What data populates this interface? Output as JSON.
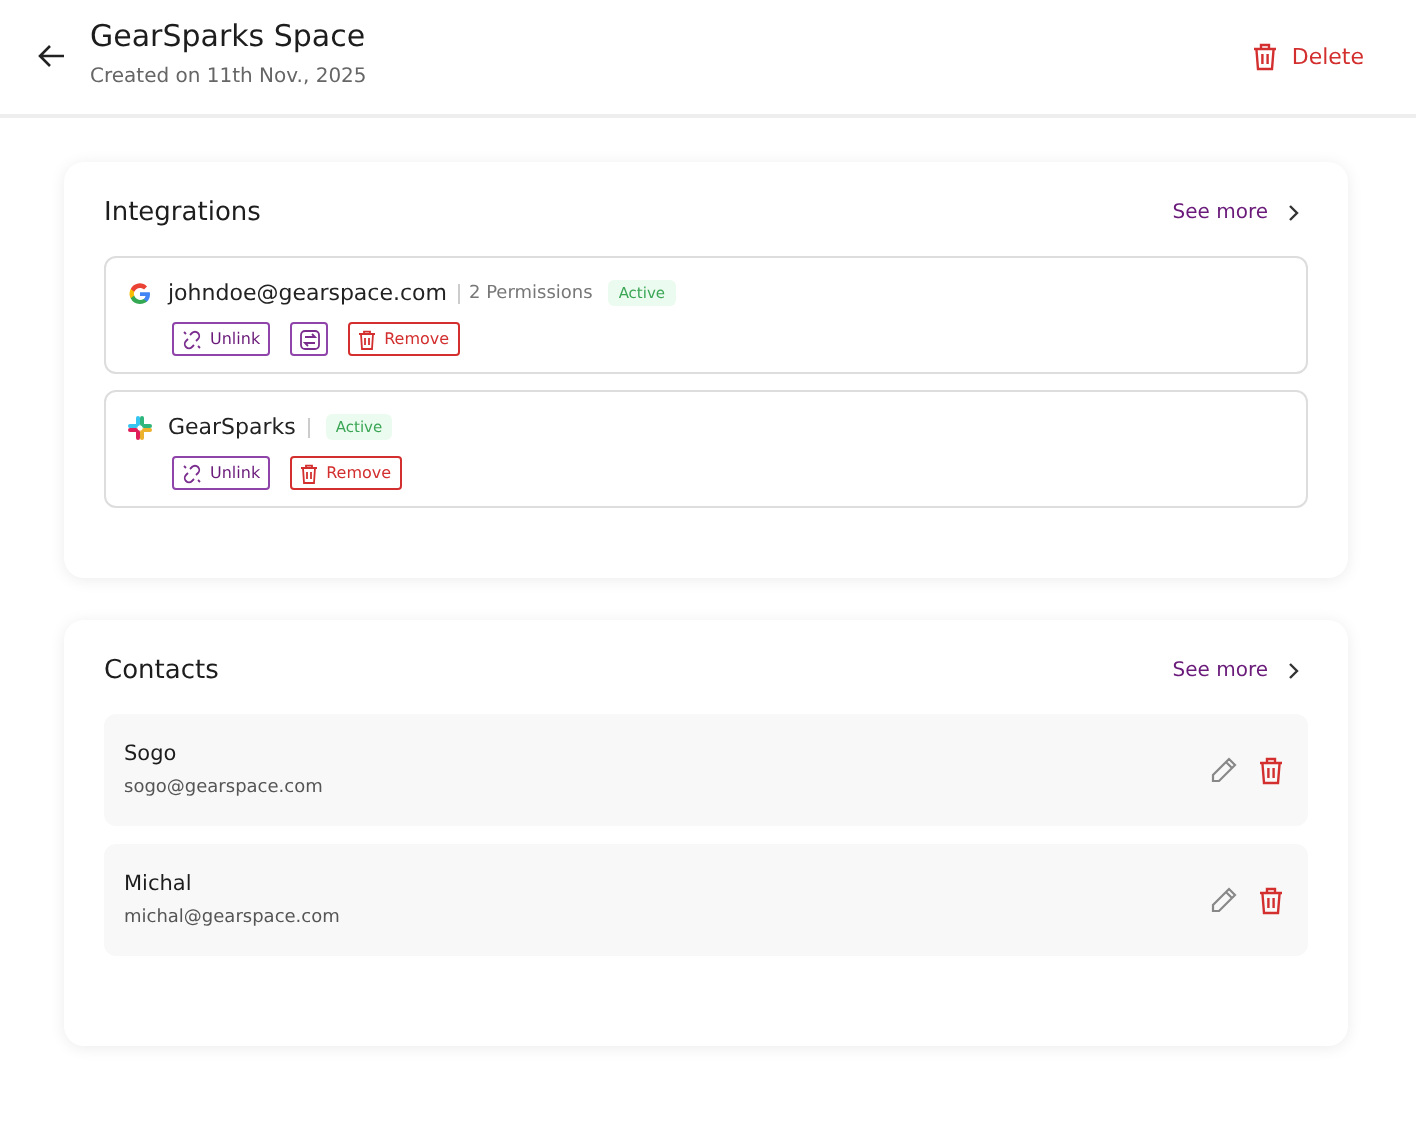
{
  "header": {
    "title": "GearSparks Space",
    "subtitle": "Created on 11th Nov., 2025",
    "delete_label": "Delete"
  },
  "integrations": {
    "title": "Integrations",
    "see_more": "See more",
    "items": [
      {
        "kind": "google",
        "name": "johndoe@gearspace.com",
        "permissions": "2 Permissions",
        "status": "Active",
        "actions": [
          {
            "kind": "unlink",
            "label": "Unlink"
          },
          {
            "kind": "sync"
          },
          {
            "kind": "remove",
            "label": "Remove"
          }
        ]
      },
      {
        "kind": "slack",
        "name": "GearSparks",
        "status": "Active",
        "actions": [
          {
            "kind": "unlink",
            "label": "Unlink"
          },
          {
            "kind": "remove",
            "label": "Remove"
          }
        ]
      }
    ]
  },
  "contacts": {
    "title": "Contacts",
    "see_more": "See more",
    "items": [
      {
        "name": "Sogo",
        "email": "sogo@gearspace.com"
      },
      {
        "name": "Michal",
        "email": "michal@gearspace.com"
      }
    ]
  }
}
